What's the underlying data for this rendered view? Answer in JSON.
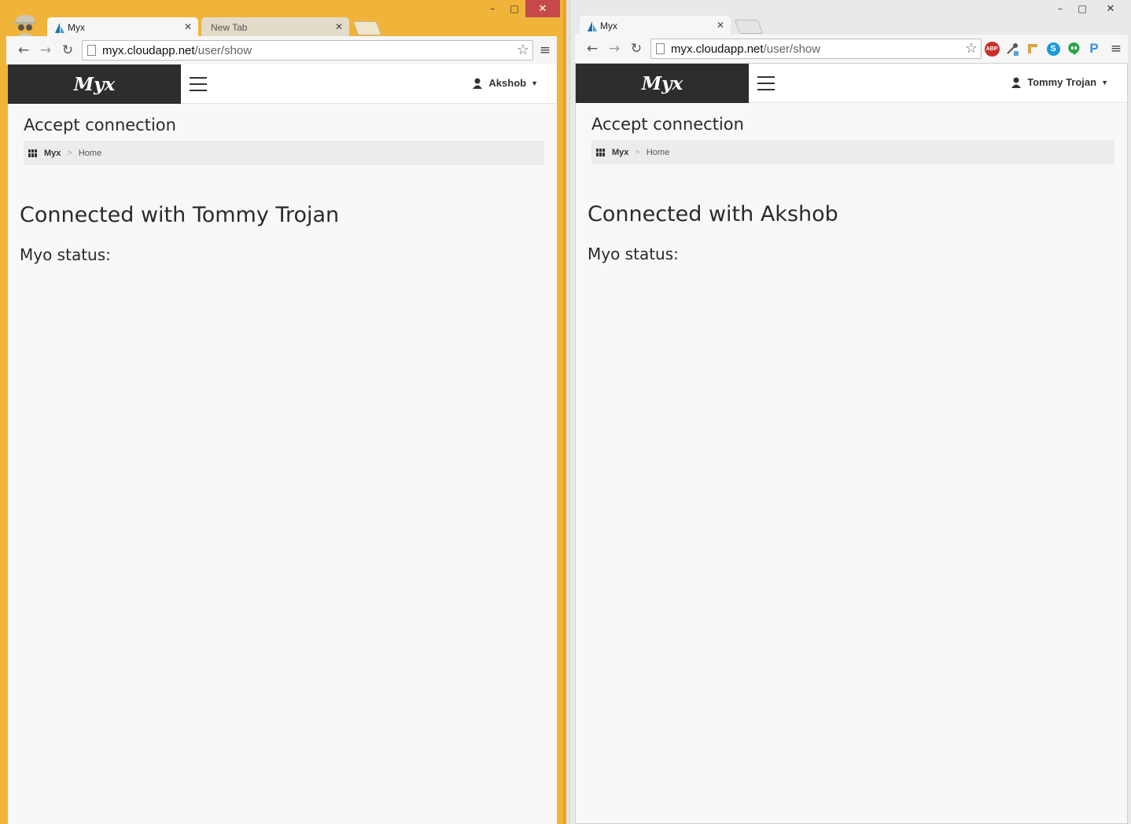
{
  "windows": [
    {
      "id": "A",
      "tabs": [
        {
          "label": "Myx",
          "active": true
        },
        {
          "label": "New Tab",
          "active": false
        }
      ],
      "url": {
        "host": "myx.cloudapp.net",
        "path": "/user/show"
      },
      "page": {
        "brand": "Myx",
        "user": "Akshob",
        "title": "Accept connection",
        "breadcrumb": [
          "Myx",
          "Home"
        ],
        "heading": "Connected with Tommy Trojan",
        "status_label": "Myo status:"
      }
    },
    {
      "id": "B",
      "tabs": [
        {
          "label": "Myx",
          "active": true
        }
      ],
      "url": {
        "host": "myx.cloudapp.net",
        "path": "/user/show"
      },
      "extensions": [
        "abp-icon",
        "eyedropper-icon",
        "ruler-icon",
        "skype-icon",
        "hangouts-icon",
        "pinterest-icon"
      ],
      "extension_text": {
        "abp": "ABP",
        "pinterest": "P",
        "skype": "S"
      },
      "page": {
        "brand": "Myx",
        "user": "Tommy Trojan",
        "title": "Accept connection",
        "breadcrumb": [
          "Myx",
          "Home"
        ],
        "heading": "Connected with Akshob",
        "status_label": "Myo status:"
      }
    }
  ],
  "colors": {
    "active_frame": "#f0b43a",
    "close_button": "#c74a4a",
    "brand_bg": "#2d2d2d"
  }
}
